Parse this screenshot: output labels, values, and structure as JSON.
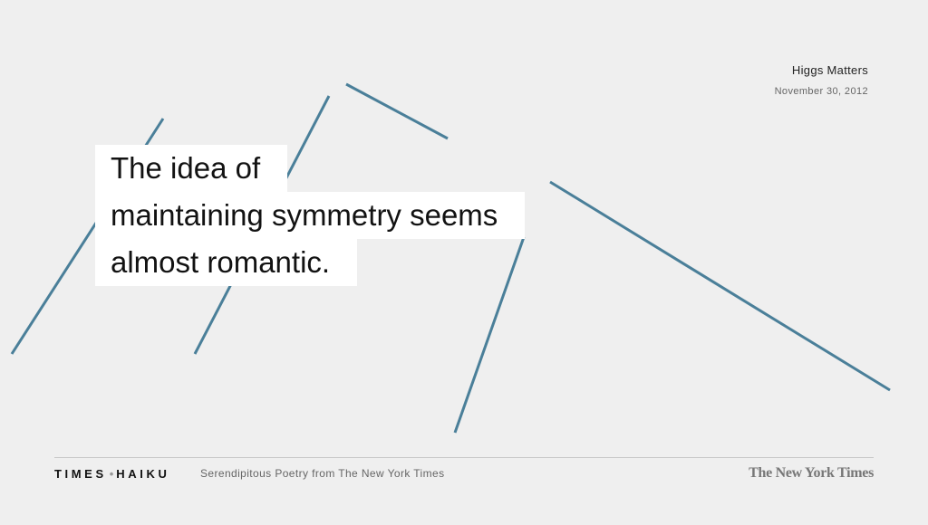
{
  "header": {
    "title": "Higgs Matters",
    "date": "November 30, 2012"
  },
  "haiku": {
    "lines": [
      "The idea of",
      "maintaining symmetry seems",
      "almost romantic."
    ]
  },
  "footer": {
    "brand_left": "TIMES",
    "brand_separator": "•",
    "brand_right": "HAIKU",
    "tagline": "Serendipitous Poetry from The New York Times",
    "logo_text": "The New York Times"
  },
  "colors": {
    "background": "#efefef",
    "line_accent": "#4a7f99",
    "text": "#121212"
  }
}
